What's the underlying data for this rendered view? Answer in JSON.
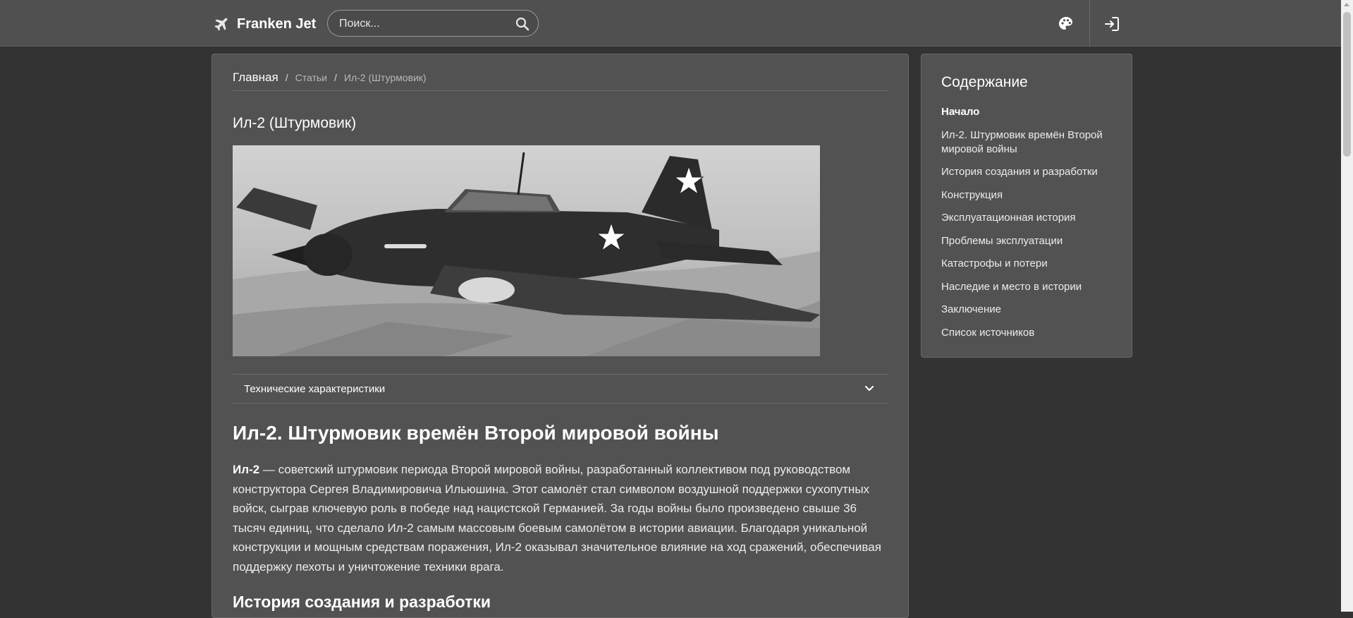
{
  "nav": {
    "brand": "Franken Jet",
    "search_placeholder": "Поиск...",
    "icons": [
      "plane-icon",
      "search-icon",
      "palette-icon",
      "sign-in-icon"
    ]
  },
  "breadcrumb": {
    "home": "Главная",
    "sep1": "/",
    "articles": "Статьи",
    "sep2": "/",
    "current": "Ил-2 (Штурмовик)"
  },
  "article": {
    "title": "Ил-2 (Штурмовик)",
    "specs_label": "Технические характеристики",
    "heading": "Ил-2. Штурмовик времён Второй мировой войны",
    "intro_bold": "Ил-2",
    "intro_text": " — советский штурмовик периода Второй мировой войны, разработанный коллективом под руководством конструктора Сергея Владимировича Ильюшина. Этот самолёт стал символом воздушной поддержки сухопутных войск, сыграв ключевую роль в победе над нацистской Германией. За годы войны было произведено свыше 36 тысяч единиц, что сделало Ил-2 самым массовым боевым самолётом в истории авиации. Благодаря уникальной конструкции и мощным средствам поражения, Ил-2 оказывал значительное влияние на ход сражений, обеспечивая поддержку пехоты и уничтожение техники врага.",
    "section2_heading": "История создания и разработки"
  },
  "toc": {
    "title": "Содержание",
    "items": [
      "Начало",
      "Ил-2. Штурмовик времён Второй мировой войны",
      "История создания и разработки",
      "Конструкция",
      "Эксплуатационная история",
      "Проблемы эксплуатации",
      "Катастрофы и потери",
      "Наследие и место в истории",
      "Заключение",
      "Список источников"
    ]
  },
  "colors": {
    "background": "#333333",
    "navbar": "#505050",
    "card": "#525252"
  }
}
